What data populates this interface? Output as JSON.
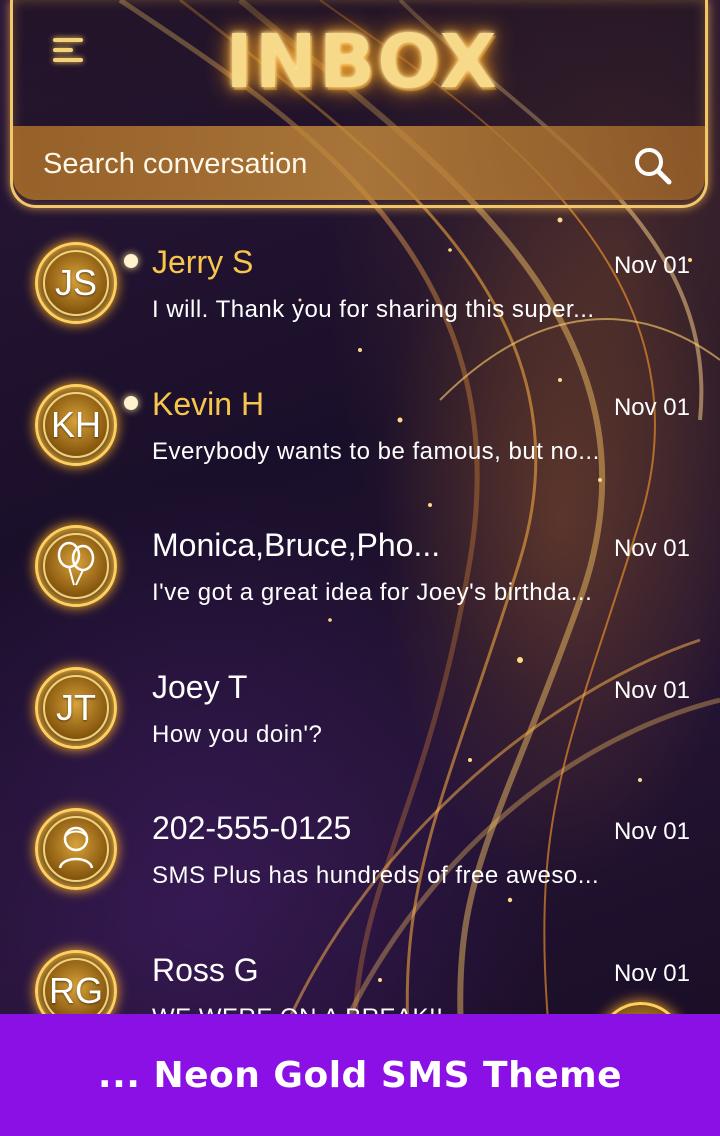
{
  "header": {
    "title": "INBOX",
    "search_placeholder": "Search conversation"
  },
  "conversations": [
    {
      "avatar": "JS",
      "avatar_icon": null,
      "name": "Jerry S",
      "date": "Nov 01",
      "preview": "I will. Thank you for sharing this super...",
      "unread": true
    },
    {
      "avatar": "KH",
      "avatar_icon": null,
      "name": "Kevin H",
      "date": "Nov 01",
      "preview": "Everybody wants to be famous, but no...",
      "unread": true
    },
    {
      "avatar": "",
      "avatar_icon": "balloons-icon",
      "name": "Monica,Bruce,Pho...",
      "date": "Nov 01",
      "preview": "I've got a great idea for Joey's birthda...",
      "unread": false
    },
    {
      "avatar": "JT",
      "avatar_icon": null,
      "name": "Joey T",
      "date": "Nov 01",
      "preview": "How you doin'?",
      "unread": false
    },
    {
      "avatar": "",
      "avatar_icon": "person-icon",
      "name": "202-555-0125",
      "date": "Nov 01",
      "preview": "SMS Plus has hundreds of free aweso...",
      "unread": false
    },
    {
      "avatar": "RG",
      "avatar_icon": null,
      "name": "Ross G",
      "date": "Nov 01",
      "preview": "WE WERE ON A BREAK!!",
      "unread": false
    }
  ],
  "banner": {
    "text": "... Neon Gold SMS Theme"
  },
  "colors": {
    "gold": "#f7c64a",
    "banner": "#8b10e6",
    "background": "#1a0f2a"
  }
}
